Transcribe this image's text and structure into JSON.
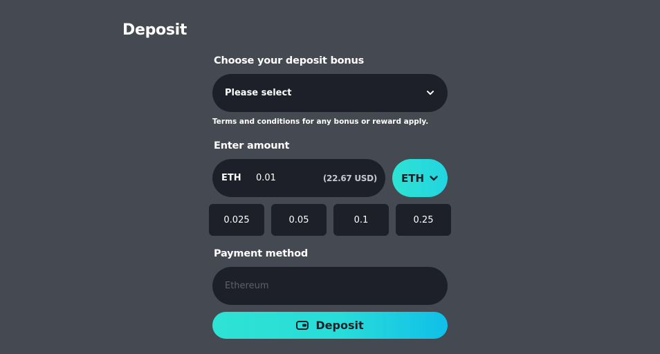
{
  "page": {
    "title": "Deposit"
  },
  "bonus": {
    "label": "Choose your deposit bonus",
    "selected": "Please select",
    "terms": "Terms and conditions for any bonus or reward apply."
  },
  "amount": {
    "label": "Enter amount",
    "currency": "ETH",
    "value": "0.01",
    "usd": "(22.67 USD)",
    "currency_button": "ETH",
    "presets": [
      "0.025",
      "0.05",
      "0.1",
      "0.25"
    ]
  },
  "payment": {
    "label": "Payment method",
    "placeholder": "Ethereum"
  },
  "deposit_button": {
    "label": "Deposit"
  },
  "colors": {
    "background": "#454951",
    "field": "#1d2028",
    "accent": "#2ee3d3",
    "accent_end": "#10bfe8"
  },
  "icons": {
    "select_chevron": "chevron-down-icon",
    "currency_chevron": "chevron-down-icon",
    "deposit": "wallet-icon"
  }
}
